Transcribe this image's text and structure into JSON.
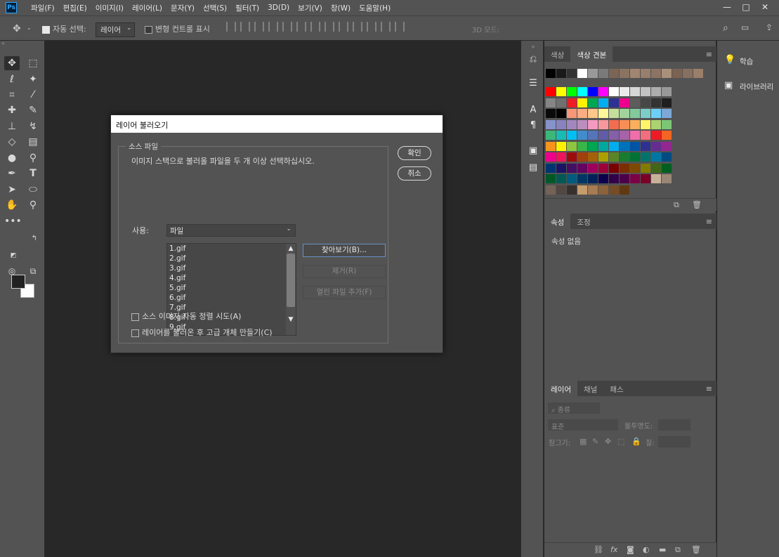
{
  "app": {
    "logo": "Ps"
  },
  "menu": [
    "파일(F)",
    "편집(E)",
    "이미지(I)",
    "레이어(L)",
    "문자(Y)",
    "선택(S)",
    "필터(T)",
    "3D(D)",
    "보기(V)",
    "창(W)",
    "도움말(H)"
  ],
  "window_controls": {
    "minimize": "—",
    "maximize": "□",
    "close": "✕"
  },
  "options_bar": {
    "auto_select_label": "자동 선택:",
    "auto_select_checked": true,
    "auto_select_value": "레이어",
    "transform_controls_label": "변형 컨트롤 표시",
    "transform_controls_checked": false,
    "mode_3d_label": "3D 모드:"
  },
  "dialog": {
    "title": "레이어 불러오기",
    "group_label": "소스 파일",
    "instruction": "이미지 스택으로 불러올 파일을 두 개 이상 선택하십시오.",
    "use_label": "사용:",
    "use_value": "파일",
    "files": [
      "1.gif",
      "2.gif",
      "3.gif",
      "4.gif",
      "5.gif",
      "6.gif",
      "7.gif",
      "8.gif",
      "9.gif"
    ],
    "browse_button": "찾아보기(B)...",
    "remove_button": "제거(R)",
    "add_open_files_button": "열린 파일 추가(F)",
    "ok_button": "확인",
    "cancel_button": "취소",
    "auto_align_label": "소스 이미지 자동 정렬 시도(A)",
    "auto_align_checked": false,
    "smart_object_label": "레이어를 불러온 후 고급 개체 만들기(C)",
    "smart_object_checked": false
  },
  "panels": {
    "color_tabs": [
      "색상",
      "색상 견본"
    ],
    "properties_tabs": [
      "속성",
      "조정"
    ],
    "properties_empty": "속성 없음",
    "layers_tabs": [
      "레이어",
      "채널",
      "패스"
    ],
    "layers_filter": "종류",
    "blend_mode": "표준",
    "opacity_label": "불투명도:",
    "lock_label": "잠그기:",
    "fill_label": "칠:"
  },
  "right_column": [
    {
      "icon": "lightbulb-icon",
      "label": "학습"
    },
    {
      "icon": "library-icon",
      "label": "라이브러리"
    }
  ],
  "swatches": {
    "recent": [
      "#000000",
      "#1a1a1a",
      "#333333",
      "#ffffff",
      "#999999",
      "#7a7a7a",
      "#7b6655",
      "#8a7361",
      "#a18570",
      "#987e6b",
      "#8c7363",
      "#a8907b",
      "#7c6351",
      "#87705f",
      "#9a7f6a"
    ],
    "rows": [
      [
        "#ff0000",
        "#ffff00",
        "#00ff00",
        "#00ffff",
        "#0000ff",
        "#ff00ff",
        "#ffffff",
        "#ebebeb",
        "#d6d6d6",
        "#c2c2c2",
        "#adadad",
        "#999999"
      ],
      [
        "#858585",
        "#707070",
        "#ed1c24",
        "#fff200",
        "#00a651",
        "#00aeef",
        "#2e3192",
        "#ec008c",
        "#5c5c5c",
        "#474747",
        "#333333",
        "#1f1f1f"
      ],
      [
        "#0a0a0a",
        "#000000",
        "#f7977a",
        "#f9ad81",
        "#fdc68a",
        "#fff79a",
        "#c4df9b",
        "#a3d39c",
        "#82ca9d",
        "#7bcdc8",
        "#6ecff6",
        "#7ea7d8"
      ],
      [
        "#8493ca",
        "#8882be",
        "#a187be",
        "#bc8dbf",
        "#f49ac2",
        "#f6989d",
        "#f26c4f",
        "#f68e55",
        "#fbaf5c",
        "#fff467",
        "#acd372",
        "#7cc576"
      ],
      [
        "#3bb878",
        "#1abbb4",
        "#00bff3",
        "#438ccb",
        "#5574b9",
        "#605ca8",
        "#855fa8",
        "#a763a8",
        "#f06eaa",
        "#f26d7d",
        "#ed1c24",
        "#f26522"
      ],
      [
        "#f7941d",
        "#fff200",
        "#8dc73f",
        "#39b54a",
        "#00a651",
        "#00a99d",
        "#00aeef",
        "#0072bc",
        "#0054a6",
        "#2e3192",
        "#662d91",
        "#92278f"
      ],
      [
        "#ec008c",
        "#ed145b",
        "#9e0b0f",
        "#a0410d",
        "#a36209",
        "#aba000",
        "#598527",
        "#1a7b30",
        "#007236",
        "#00746b",
        "#0076a3",
        "#004b80"
      ],
      [
        "#003471",
        "#1b1464",
        "#440e62",
        "#630460",
        "#9e005d",
        "#9e0039",
        "#790000",
        "#7b2e00",
        "#7d4900",
        "#827b00",
        "#406618",
        "#005e20"
      ],
      [
        "#005826",
        "#005952",
        "#005b7f",
        "#003663",
        "#002157",
        "#0d004c",
        "#32004b",
        "#4b0049",
        "#7b0046",
        "#7a0026",
        "#c7b299",
        "#998675"
      ]
    ],
    "last_row": [
      "#736357",
      "#534741",
      "#37302d",
      "#c69c6d",
      "#a67c52",
      "#8c6239",
      "#754c24",
      "#603913"
    ]
  }
}
